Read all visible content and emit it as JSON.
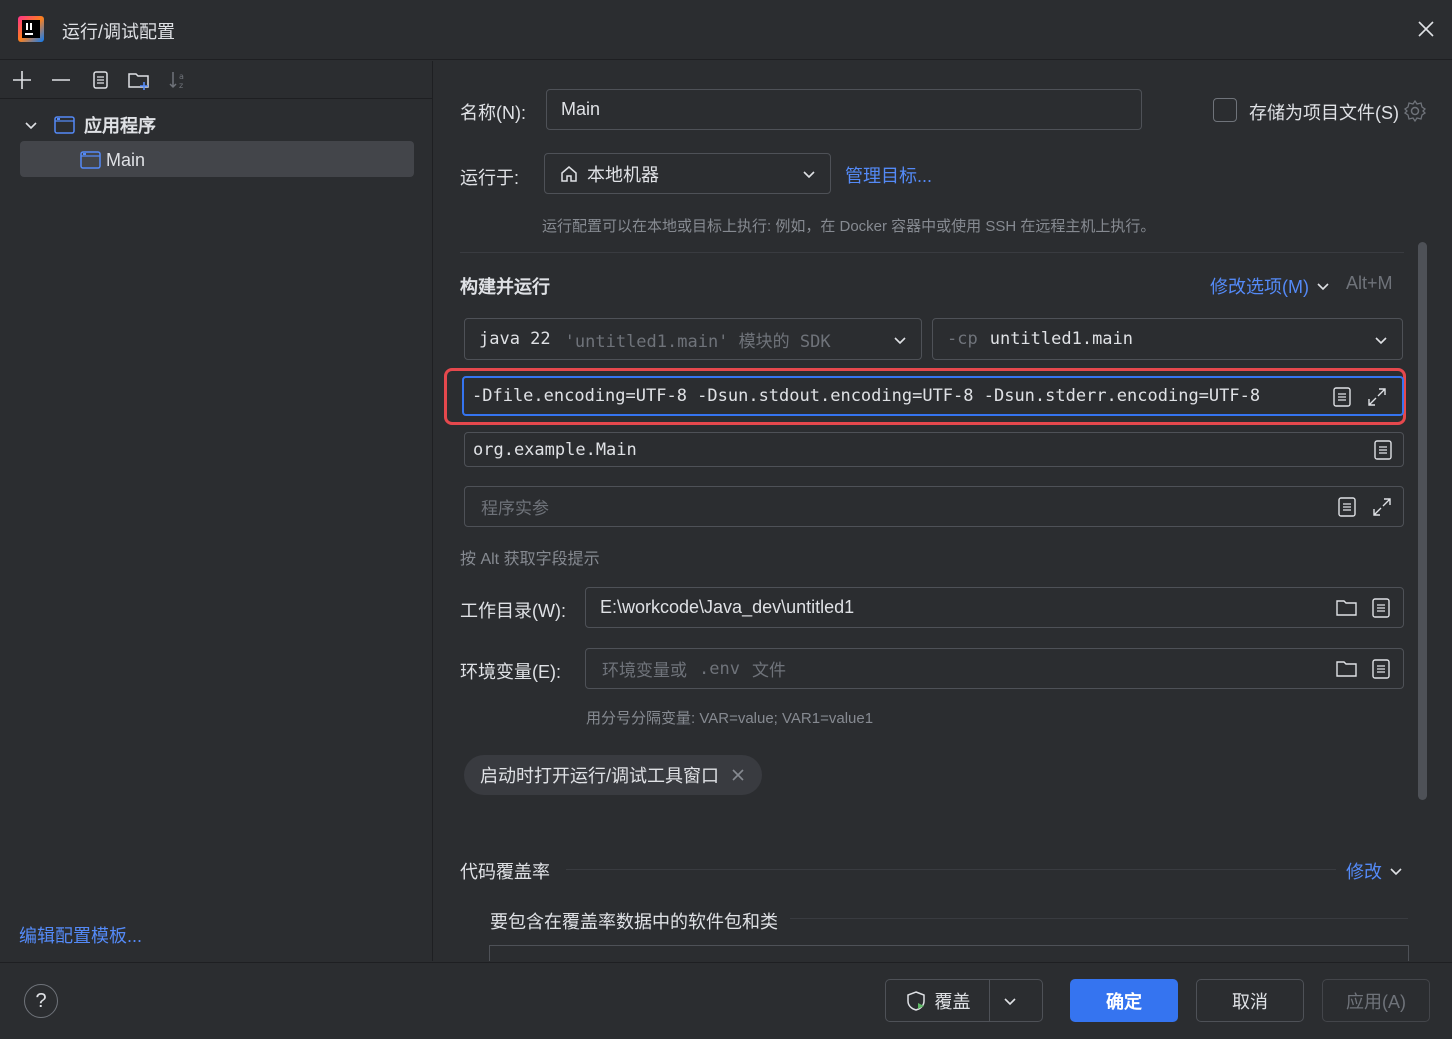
{
  "window": {
    "title": "运行/调试配置"
  },
  "left": {
    "tree": {
      "group_label": "应用程序",
      "items": [
        {
          "label": "Main",
          "selected": true
        }
      ]
    },
    "edit_templates_link": "编辑配置模板..."
  },
  "form": {
    "name_label": "名称(N):",
    "name_value": "Main",
    "store_as_project_file_label": "存储为项目文件(S)",
    "run_on_label": "运行于:",
    "run_on_value": "本地机器",
    "manage_targets_link": "管理目标...",
    "run_on_hint": "运行配置可以在本地或目标上执行: 例如，在 Docker 容器中或使用 SSH 在远程主机上执行。",
    "build_run_title": "构建并运行",
    "modify_options_link": "修改选项(M)",
    "modify_options_shortcut": "Alt+M",
    "sdk": {
      "main": "java 22",
      "detail": "'untitled1.main' 模块的 SDK"
    },
    "classpath": {
      "flag": "-cp",
      "value": "untitled1.main"
    },
    "vm_options_value": "-Dfile.encoding=UTF-8 -Dsun.stdout.encoding=UTF-8 -Dsun.stderr.encoding=UTF-8",
    "main_class_value": "org.example.Main",
    "program_args_placeholder": "程序实参",
    "alt_hint": "按 Alt 获取字段提示",
    "working_dir_label": "工作目录(W):",
    "working_dir_value": "E:\\workcode\\Java_dev\\untitled1",
    "env_label": "环境变量(E):",
    "env_placeholder_a": "环境变量或",
    "env_placeholder_b": ".env",
    "env_placeholder_c": "文件",
    "env_hint": "用分号分隔变量: VAR=value; VAR1=value1",
    "chip_label": "启动时打开运行/调试工具窗口",
    "coverage_title": "代码覆盖率",
    "coverage_modify_link": "修改",
    "coverage_desc": "要包含在覆盖率数据中的软件包和类"
  },
  "footer": {
    "help": "?",
    "cover_button": "覆盖",
    "ok_button": "确定",
    "cancel_button": "取消",
    "apply_button": "应用(A)"
  },
  "colors": {
    "background": "#2b2d30",
    "accent": "#3574f0",
    "link": "#548af7",
    "highlight_box": "#e5484d"
  }
}
